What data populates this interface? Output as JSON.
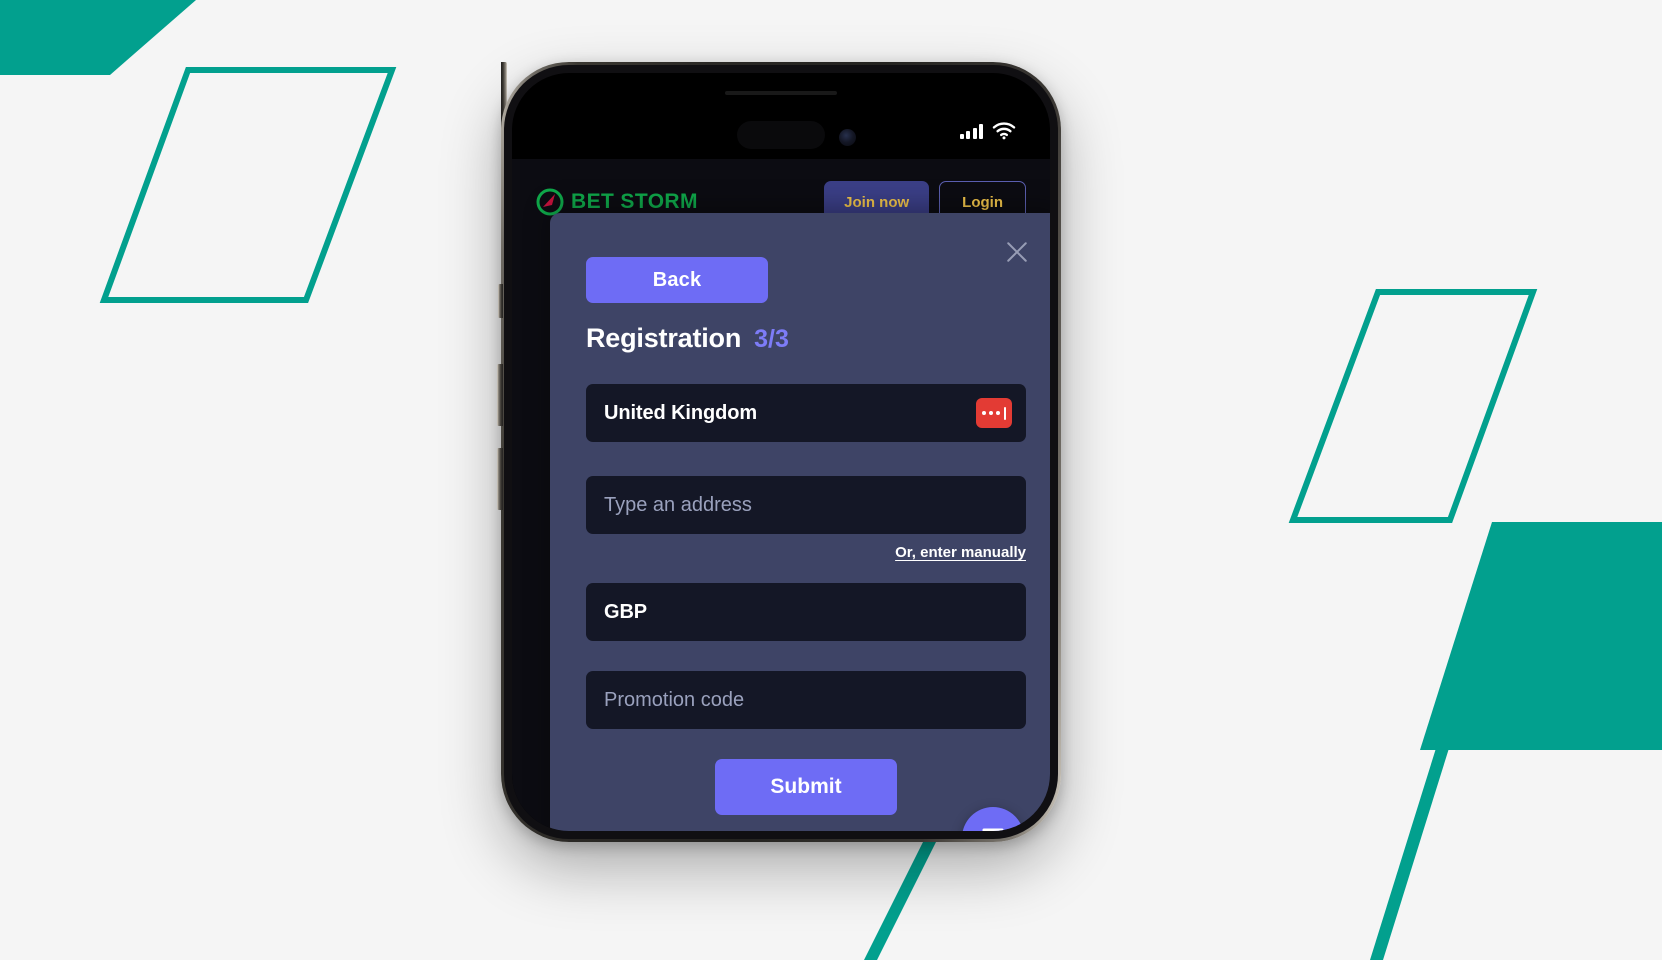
{
  "background": {
    "page_color": "#f5f5f5",
    "accent_color": "#02a08e"
  },
  "phone": {
    "status_bar": {
      "signal_icon": "cellular-signal-icon",
      "wifi_icon": "wifi-icon"
    }
  },
  "site": {
    "brand": {
      "logo_icon": "bet-storm-logo-icon",
      "name": "BET STORM",
      "color": "#0fa84a"
    },
    "header_buttons": {
      "join": "Join now",
      "login": "Login"
    }
  },
  "modal": {
    "close_icon": "close-icon",
    "back_label": "Back",
    "title": "Registration",
    "step": "3/3",
    "fields": [
      {
        "name": "country",
        "value": "United Kingdom",
        "placeholder": "",
        "badge_icon": "flag-badge-icon",
        "badge_color": "#e33b34"
      },
      {
        "name": "address",
        "value": "",
        "placeholder": "Type an address"
      },
      {
        "name": "currency",
        "value": "GBP",
        "placeholder": ""
      },
      {
        "name": "promo",
        "value": "",
        "placeholder": "Promotion code"
      }
    ],
    "manual_link": "Or, enter manually",
    "submit_label": "Submit",
    "accent_color": "#6e6cf5",
    "panel_color": "#3e4466",
    "input_color": "#141726"
  },
  "intercom": {
    "icon": "intercom-chat-icon",
    "color": "#6e6cf5"
  }
}
